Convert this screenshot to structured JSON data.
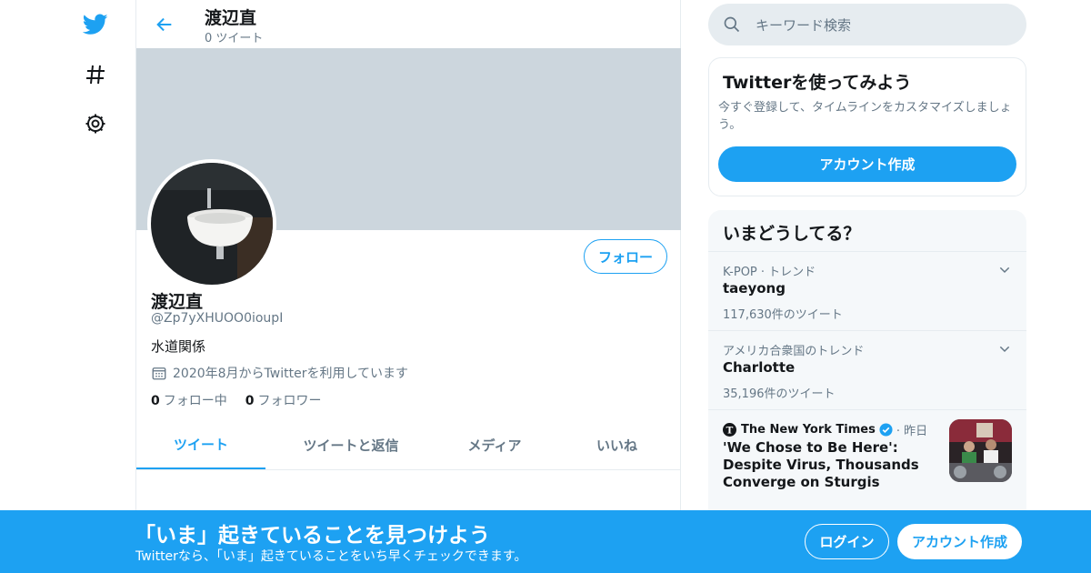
{
  "colors": {
    "accent": "#1da1f2",
    "banner": "#ccd6dd",
    "muted": "#657786",
    "verified": "#1da1f2"
  },
  "leftnav": {
    "icons": [
      "twitter-logo-icon",
      "hashtag-icon",
      "gear-icon"
    ]
  },
  "header": {
    "name": "渡辺直",
    "tweet_count": "0 ツイート"
  },
  "profile": {
    "name": "渡辺直",
    "handle": "@Zp7yXHUOO0ioupI",
    "bio": "水道関係",
    "joined": "2020年8月からTwitterを利用しています",
    "following_count": "0",
    "following_label": "フォロー中",
    "followers_count": "0",
    "followers_label": "フォロワー",
    "follow_button": "フォロー"
  },
  "tabs": [
    {
      "label": "ツイート",
      "active": true
    },
    {
      "label": "ツイートと返信",
      "active": false
    },
    {
      "label": "メディア",
      "active": false
    },
    {
      "label": "いいね",
      "active": false
    }
  ],
  "search": {
    "placeholder": "キーワード検索"
  },
  "signup_card": {
    "title": "Twitterを使ってみよう",
    "description": "今すぐ登録して、タイムラインをカスタマイズしましょう。",
    "button": "アカウント作成"
  },
  "trends": {
    "title": "いまどうしてる？",
    "items": [
      {
        "meta": "K-POP · トレンド",
        "topic": "taeyong",
        "count": "117,630件のツイート"
      },
      {
        "meta": "アメリカ合衆国のトレンド",
        "topic": "Charlotte",
        "count": "35,196件のツイート"
      }
    ],
    "news": {
      "source": "The New York Times",
      "time": "· 昨日",
      "headline": "'We Chose to Be Here': Despite Virus, Thousands Converge on Sturgis"
    }
  },
  "bottom_bar": {
    "title": "「いま」起きていることを見つけよう",
    "subtitle": "Twitterなら、「いま」起きていることをいち早くチェックできます。",
    "login": "ログイン",
    "signup": "アカウント作成"
  }
}
